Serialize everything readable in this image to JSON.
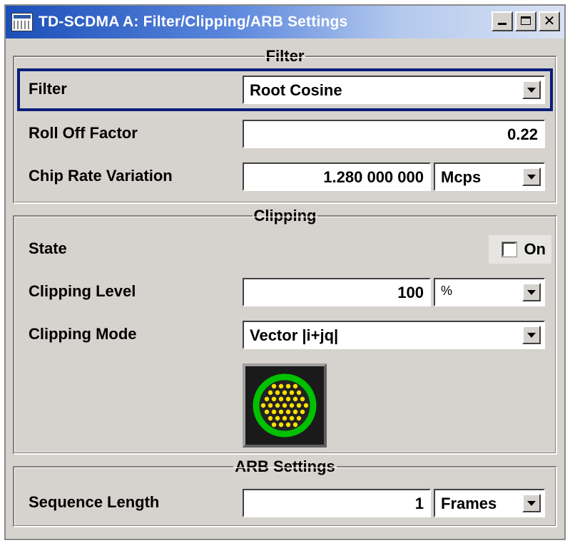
{
  "window": {
    "title": "TD-SCDMA A: Filter/Clipping/ARB Settings",
    "controls": [
      "minimize-icon",
      "maximize-icon",
      "close-icon"
    ],
    "close_glyph": "✕"
  },
  "filter_section": {
    "title": "Filter",
    "filter": {
      "label": "Filter",
      "value": "Root Cosine"
    },
    "roll_off": {
      "label": "Roll Off Factor",
      "value": "0.22"
    },
    "chip_rate": {
      "label": "Chip Rate Variation",
      "value": "1.280 000 000",
      "unit": "Mcps"
    }
  },
  "clipping_section": {
    "title": "Clipping",
    "state": {
      "label": "State",
      "checkbox_label": "On",
      "checked": false
    },
    "level": {
      "label": "Clipping Level",
      "value": "100",
      "unit": "%"
    },
    "mode": {
      "label": "Clipping Mode",
      "value": "Vector |i+jq|"
    },
    "graphic": {
      "icon": "constellation-icon",
      "ring_color": "#00c000",
      "dot_color": "#ffe000"
    }
  },
  "arb_section": {
    "title": "ARB Settings",
    "sequence_length": {
      "label": "Sequence Length",
      "value": "1",
      "unit": "Frames"
    }
  },
  "colors": {
    "panel": "#d6d3ce",
    "titlebar_start": "#1b4fb8",
    "focus_border": "#0a1e7a"
  }
}
